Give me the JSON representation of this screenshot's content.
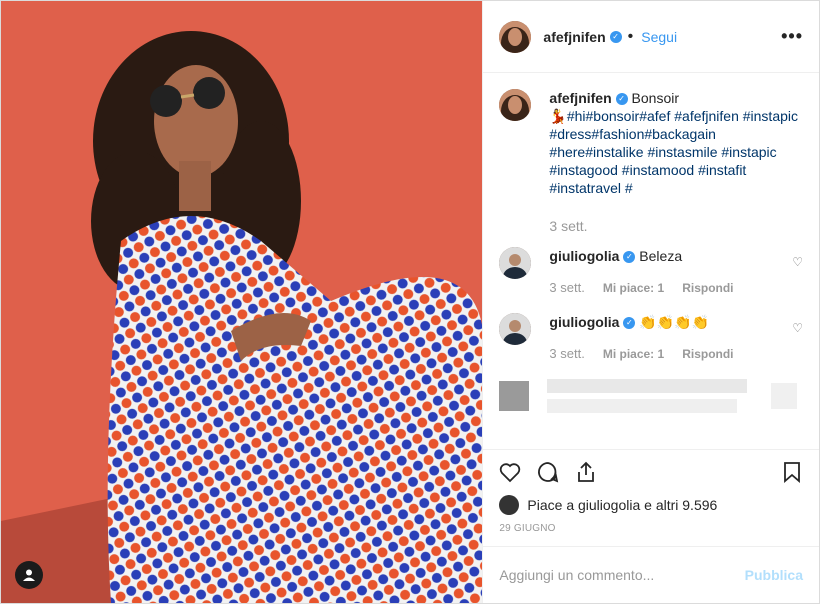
{
  "post": {
    "username": "afefjnifen",
    "follow_label": "Segui",
    "caption_title": "Bonsoir",
    "caption_tags": "💃#hi#bonsoir#afef #afefjnifen #instapic #dress#fashion#backagain #here#instalike #instasmile #instapic #instagood #instamood #instafit #instatravel #",
    "caption_time": "3 sett."
  },
  "comments": [
    {
      "user": "giuliogolia",
      "text": "Beleza",
      "time": "3 sett.",
      "likes": "Mi piace: 1",
      "reply": "Rispondi"
    },
    {
      "user": "giuliogolia",
      "text": "👏👏👏👏",
      "time": "3 sett.",
      "likes": "Mi piace: 1",
      "reply": "Rispondi"
    }
  ],
  "likes_text": "Piace a giuliogolia e altri 9.596",
  "date": "29 GIUGNO",
  "add_comment_placeholder": "Aggiungi un commento...",
  "publish_label": "Pubblica",
  "icons": [
    "heart-icon",
    "comment-icon",
    "share-icon",
    "bookmark-icon",
    "more-icon",
    "user-tag-icon",
    "verified-icon"
  ]
}
